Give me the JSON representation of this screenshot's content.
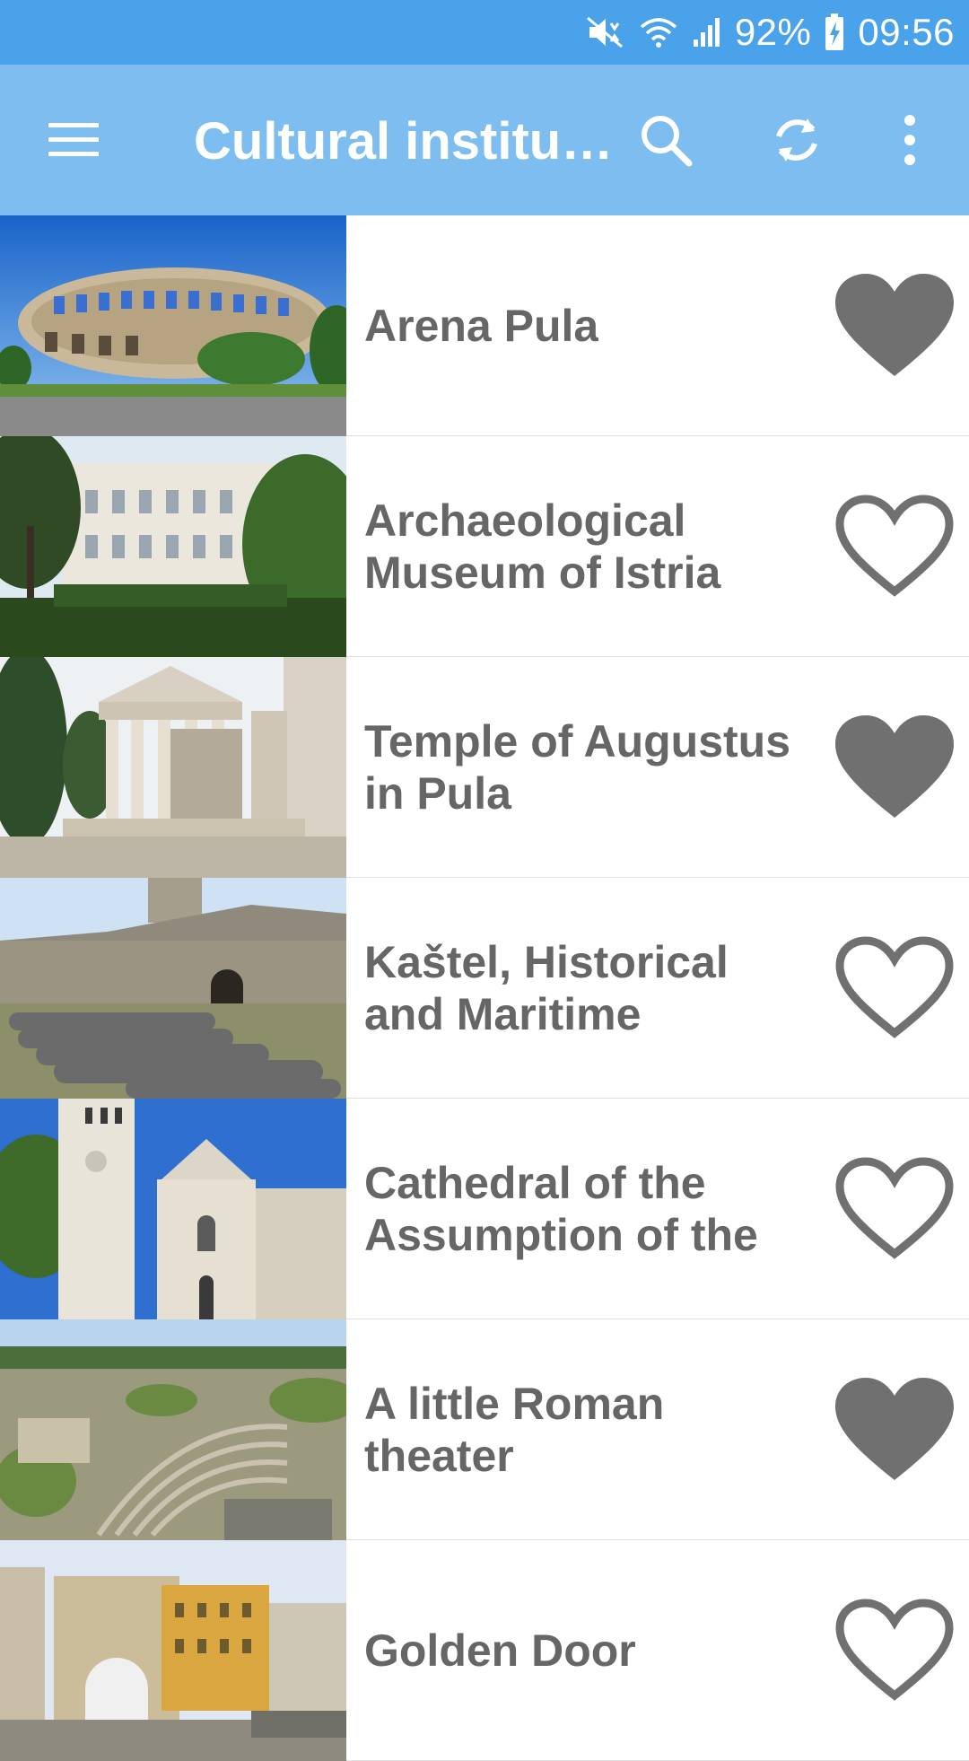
{
  "status_bar": {
    "battery": "92%",
    "time": "09:56",
    "icons": [
      "mute-icon",
      "wifi-icon",
      "signal-icon",
      "battery-charging-icon"
    ]
  },
  "app_bar": {
    "title": "Cultural institu…",
    "icons": [
      "menu-icon",
      "search-icon",
      "refresh-icon",
      "more-vert-icon"
    ]
  },
  "colors": {
    "status_bar": "#4aa3ea",
    "app_bar": "#7dbdf0",
    "heart": "#707070",
    "title_text": "#666666"
  },
  "items": [
    {
      "title": "Arena Pula",
      "favorite": true,
      "image": "colosseum-photo"
    },
    {
      "title": "Archaeological Museum of Istria",
      "favorite": false,
      "image": "museum-building-photo"
    },
    {
      "title": "Temple of Augustus in Pula",
      "favorite": true,
      "image": "temple-photo"
    },
    {
      "title": "Kaštel, Historical and Maritime",
      "favorite": false,
      "image": "fortress-cannons-photo"
    },
    {
      "title": "Cathedral of the Assumption of the",
      "favorite": false,
      "image": "cathedral-photo"
    },
    {
      "title": "A little Roman theater",
      "favorite": true,
      "image": "roman-theater-photo"
    },
    {
      "title": "Golden Door",
      "favorite": false,
      "image": "golden-gate-photo"
    }
  ]
}
